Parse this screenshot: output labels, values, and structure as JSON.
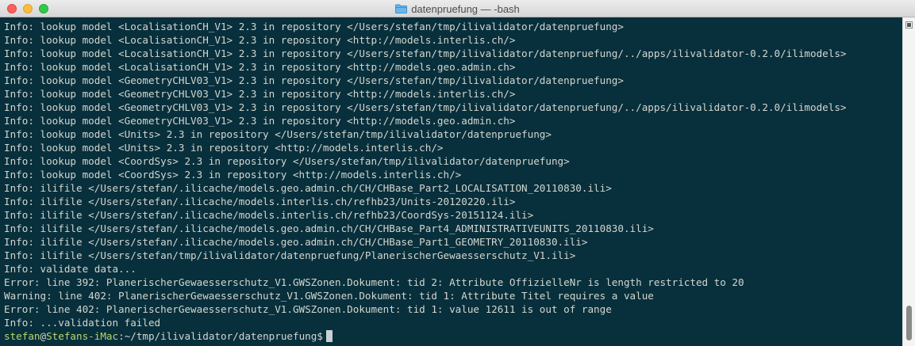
{
  "window": {
    "title": "datenpruefung — -bash"
  },
  "colors": {
    "background": "#082f3c",
    "text": "#d3d7cf",
    "prompt": "#b5d96a"
  },
  "terminal": {
    "lines": [
      "Info: lookup model <LocalisationCH_V1> 2.3 in repository </Users/stefan/tmp/ilivalidator/datenpruefung>",
      "Info: lookup model <LocalisationCH_V1> 2.3 in repository <http://models.interlis.ch/>",
      "Info: lookup model <LocalisationCH_V1> 2.3 in repository </Users/stefan/tmp/ilivalidator/datenpruefung/../apps/ilivalidator-0.2.0/ilimodels>",
      "Info: lookup model <LocalisationCH_V1> 2.3 in repository <http://models.geo.admin.ch>",
      "Info: lookup model <GeometryCHLV03_V1> 2.3 in repository </Users/stefan/tmp/ilivalidator/datenpruefung>",
      "Info: lookup model <GeometryCHLV03_V1> 2.3 in repository <http://models.interlis.ch/>",
      "Info: lookup model <GeometryCHLV03_V1> 2.3 in repository </Users/stefan/tmp/ilivalidator/datenpruefung/../apps/ilivalidator-0.2.0/ilimodels>",
      "Info: lookup model <GeometryCHLV03_V1> 2.3 in repository <http://models.geo.admin.ch>",
      "Info: lookup model <Units> 2.3 in repository </Users/stefan/tmp/ilivalidator/datenpruefung>",
      "Info: lookup model <Units> 2.3 in repository <http://models.interlis.ch/>",
      "Info: lookup model <CoordSys> 2.3 in repository </Users/stefan/tmp/ilivalidator/datenpruefung>",
      "Info: lookup model <CoordSys> 2.3 in repository <http://models.interlis.ch/>",
      "Info: ilifile </Users/stefan/.ilicache/models.geo.admin.ch/CH/CHBase_Part2_LOCALISATION_20110830.ili>",
      "Info: ilifile </Users/stefan/.ilicache/models.interlis.ch/refhb23/Units-20120220.ili>",
      "Info: ilifile </Users/stefan/.ilicache/models.interlis.ch/refhb23/CoordSys-20151124.ili>",
      "Info: ilifile </Users/stefan/.ilicache/models.geo.admin.ch/CH/CHBase_Part4_ADMINISTRATIVEUNITS_20110830.ili>",
      "Info: ilifile </Users/stefan/.ilicache/models.geo.admin.ch/CH/CHBase_Part1_GEOMETRY_20110830.ili>",
      "Info: ilifile </Users/stefan/tmp/ilivalidator/datenpruefung/PlanerischerGewaesserschutz_V1.ili>",
      "Info: validate data...",
      "Error: line 392: PlanerischerGewaesserschutz_V1.GWSZonen.Dokument: tid 2: Attribute OffizielleNr is length restricted to 20",
      "Warning: line 402: PlanerischerGewaesserschutz_V1.GWSZonen.Dokument: tid 1: Attribute Titel requires a value",
      "Error: line 402: PlanerischerGewaesserschutz_V1.GWSZonen.Dokument: tid 1: value 12611 is out of range",
      "Info: ...validation failed"
    ],
    "prompt": {
      "user": "stefan",
      "at": "@",
      "host": "Stefans-iMac",
      "colon": ":",
      "path": "~/tmp/ilivalidator/datenpruefung$"
    }
  }
}
